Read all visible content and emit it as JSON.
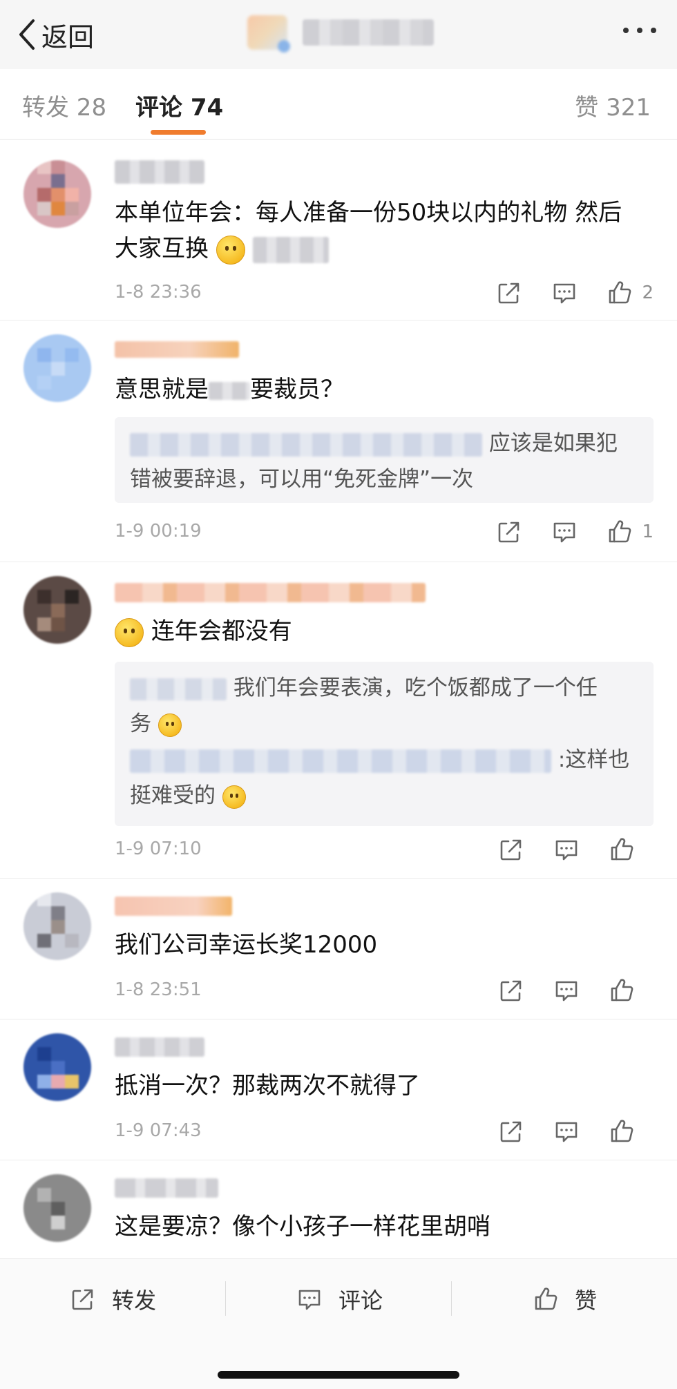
{
  "nav": {
    "back_label": "返回"
  },
  "tabs": {
    "repost": "转发 28",
    "comments": "评论 74",
    "likes": "赞 321"
  },
  "comments": [
    {
      "text_a": "本单位年会：每人准备一份50块以内的礼物 然后",
      "text_b": "大家互换",
      "time": "1-8 23:36",
      "likes": "2"
    },
    {
      "text_a": "意思就是",
      "text_b": "要裁员？",
      "reply": "应该是如果犯",
      "reply_b": "错被要辞退，可以用“免死金牌”一次",
      "time": "1-9 00:19",
      "likes": "1"
    },
    {
      "text_a": "连年会都没有",
      "reply": "我们年会要表演，吃个饭都成了一个任",
      "reply_b": "务",
      "reply2": ":这样也",
      "reply2_b": "挺难受的",
      "time": "1-9 07:10",
      "likes": ""
    },
    {
      "text_a": "我们公司幸运长奖12000",
      "time": "1-8 23:51",
      "likes": ""
    },
    {
      "text_a": "抵消一次？那裁两次不就得了",
      "time": "1-9 07:43",
      "likes": ""
    },
    {
      "text_a": "这是要凉？像个小孩子一样花里胡哨"
    }
  ],
  "bottom": {
    "repost": "转发",
    "comment": "评论",
    "like": "赞"
  },
  "icons": {
    "back": "chevron-left-icon",
    "more": "more-dots-icon",
    "share": "share-icon",
    "comment": "comment-icon",
    "like": "thumbs-up-icon"
  },
  "colors": {
    "accent": "#f07c2e",
    "meta": "#a8a8a8",
    "reply_bg": "#f4f4f6"
  }
}
